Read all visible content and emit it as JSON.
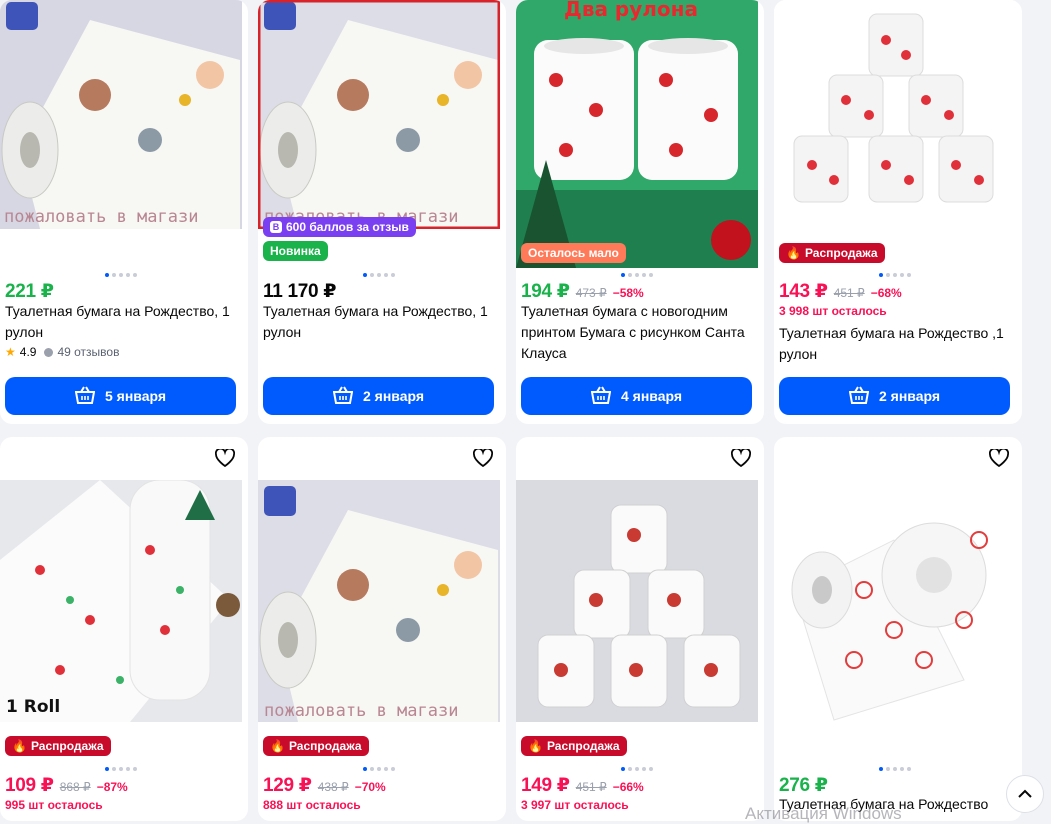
{
  "icons": {
    "wishlist": "heart-icon",
    "cart": "basket-icon",
    "fire": "fire-icon",
    "bonus": "ozon-b-icon",
    "scroll_up": "chevron-up-icon",
    "star": "star-icon",
    "review": "chat-bubble-icon"
  },
  "colors": {
    "accent": "#005bff",
    "price_green": "#19b24b",
    "price_red": "#f91155",
    "sale_badge": "#c80b2b"
  },
  "row1": [
    {
      "image_text": "пожаловать в магази",
      "price": "221 ₽",
      "title": "Туалетная бумага на Рождество, 1 рулон",
      "rating": "4.9",
      "reviews": "49 отзывов",
      "button": "5 января"
    },
    {
      "image_text": "пожаловать в магази",
      "badge_bonus": "600 баллов за отзыв",
      "badge_new": "Новинка",
      "price": "11 170 ₽",
      "title": "Туалетная бумага на Рождество, 1 рулон",
      "button": "2 января"
    },
    {
      "image_text": "Два рулона",
      "badge_low": "Осталось мало",
      "price": "194 ₽",
      "old_price": "473 ₽",
      "discount": "−58%",
      "title": "Туалетная бумага с новогодним принтом Бумага с рисунком Санта Клауса",
      "button": "4 января"
    },
    {
      "badge_sale": "Распродажа",
      "price": "143 ₽",
      "old_price": "451 ₽",
      "discount": "−68%",
      "stock": "3 998 шт осталось",
      "title": "Туалетная бумага на Рождество ,1 рулон",
      "button": "2 января"
    }
  ],
  "row2": [
    {
      "image_text": "1 Roll",
      "badge_sale": "Распродажа",
      "price": "109 ₽",
      "old_price": "868 ₽",
      "discount": "−87%",
      "stock": "995 шт осталось"
    },
    {
      "image_text": "пожаловать в магази",
      "badge_sale": "Распродажа",
      "price": "129 ₽",
      "old_price": "438 ₽",
      "discount": "−70%",
      "stock": "888 шт осталось"
    },
    {
      "badge_sale": "Распродажа",
      "price": "149 ₽",
      "old_price": "451 ₽",
      "discount": "−66%",
      "stock": "3 997 шт осталось"
    },
    {
      "price": "276 ₽",
      "title": "Туалетная бумага на Рождество"
    }
  ],
  "watermark": "Активация Windows"
}
